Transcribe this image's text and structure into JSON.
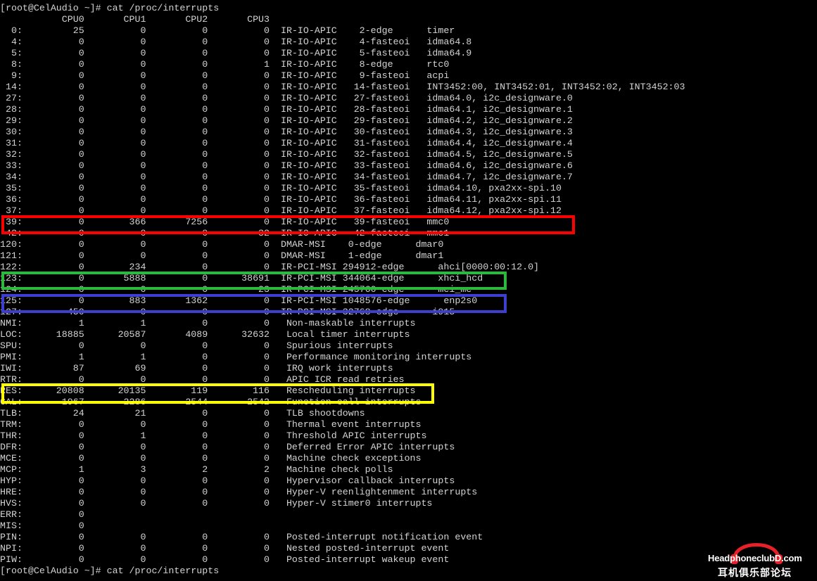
{
  "terminal": {
    "lines": [
      "[root@CelAudio ~]# cat /proc/interrupts",
      "           CPU0       CPU1       CPU2       CPU3",
      "  0:         25          0          0          0  IR-IO-APIC    2-edge      timer",
      "  4:          0          0          0          0  IR-IO-APIC    4-fasteoi   idma64.8",
      "  5:          0          0          0          0  IR-IO-APIC    5-fasteoi   idma64.9",
      "  8:          0          0          0          1  IR-IO-APIC    8-edge      rtc0",
      "  9:          0          0          0          0  IR-IO-APIC    9-fasteoi   acpi",
      " 14:          0          0          0          0  IR-IO-APIC   14-fasteoi   INT3452:00, INT3452:01, INT3452:02, INT3452:03",
      " 27:          0          0          0          0  IR-IO-APIC   27-fasteoi   idma64.0, i2c_designware.0",
      " 28:          0          0          0          0  IR-IO-APIC   28-fasteoi   idma64.1, i2c_designware.1",
      " 29:          0          0          0          0  IR-IO-APIC   29-fasteoi   idma64.2, i2c_designware.2",
      " 30:          0          0          0          0  IR-IO-APIC   30-fasteoi   idma64.3, i2c_designware.3",
      " 31:          0          0          0          0  IR-IO-APIC   31-fasteoi   idma64.4, i2c_designware.4",
      " 32:          0          0          0          0  IR-IO-APIC   32-fasteoi   idma64.5, i2c_designware.5",
      " 33:          0          0          0          0  IR-IO-APIC   33-fasteoi   idma64.6, i2c_designware.6",
      " 34:          0          0          0          0  IR-IO-APIC   34-fasteoi   idma64.7, i2c_designware.7",
      " 35:          0          0          0          0  IR-IO-APIC   35-fasteoi   idma64.10, pxa2xx-spi.10",
      " 36:          0          0          0          0  IR-IO-APIC   36-fasteoi   idma64.11, pxa2xx-spi.11",
      " 37:          0          0          0          0  IR-IO-APIC   37-fasteoi   idma64.12, pxa2xx-spi.12",
      " 39:          0        366       7256          0  IR-IO-APIC   39-fasteoi   mmc0",
      " 42:          0          0          0         32  IR-IO-APIC   42-fasteoi   mmc1",
      "120:          0          0          0          0  DMAR-MSI    0-edge      dmar0",
      "121:          0          0          0          0  DMAR-MSI    1-edge      dmar1",
      "122:          0        234          0          0  IR-PCI-MSI 294912-edge      ahci[0000:00:12.0]",
      "123:          0       5888          0      38691  IR-PCI-MSI 344064-edge      xhci_hcd",
      "124:          0          0          0         23  IR-PCI-MSI 245760-edge      mei_me",
      "125:          0        883       1362          0  IR-PCI-MSI 1048576-edge      enp2s0",
      "127:        450          0          0          0  IR-PCI-MSI 32768-edge      i915",
      "NMI:          1          1          0          0   Non-maskable interrupts",
      "LOC:      18885      20587       4089      32632   Local timer interrupts",
      "SPU:          0          0          0          0   Spurious interrupts",
      "PMI:          1          1          0          0   Performance monitoring interrupts",
      "IWI:         87         69          0          0   IRQ work interrupts",
      "RTR:          0          0          0          0   APIC ICR read retries",
      "RES:      20808      20135        119        116   Rescheduling interrupts",
      "CAL:       1967       2286       2544       2542   Function call interrupts",
      "TLB:         24         21          0          0   TLB shootdowns",
      "TRM:          0          0          0          0   Thermal event interrupts",
      "THR:          0          1          0          0   Threshold APIC interrupts",
      "DFR:          0          0          0          0   Deferred Error APIC interrupts",
      "MCE:          0          0          0          0   Machine check exceptions",
      "MCP:          1          3          2          2   Machine check polls",
      "HYP:          0          0          0          0   Hypervisor callback interrupts",
      "HRE:          0          0          0          0   Hyper-V reenlightenment interrupts",
      "HVS:          0          0          0          0   Hyper-V stimer0 interrupts",
      "ERR:          0",
      "MIS:          0",
      "PIN:          0          0          0          0   Posted-interrupt notification event",
      "NPI:          0          0          0          0   Nested posted-interrupt event",
      "PIW:          0          0          0          0   Posted-interrupt wakeup event",
      "[root@CelAudio ~]# cat /proc/interrupts"
    ]
  },
  "highlights": {
    "red": "#ff0000",
    "green": "#2db83d",
    "blue": "#3f3fcf",
    "yellow": "#ffff00"
  },
  "watermark": {
    "brand_en": "HeadphoneclubD.com",
    "brand_cn": "耳机俱乐部论坛",
    "accent_color": "#e8202a"
  }
}
